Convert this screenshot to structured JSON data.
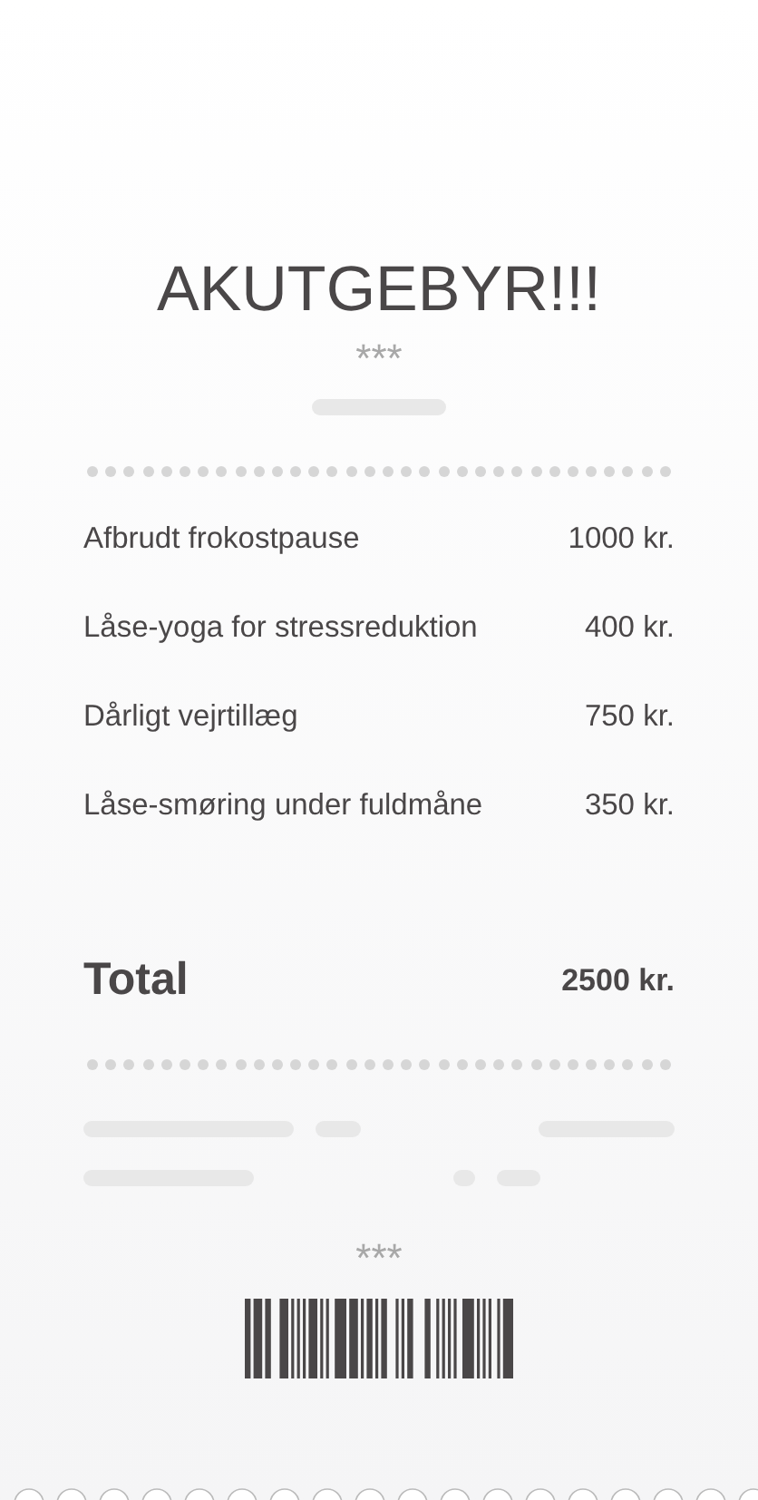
{
  "title": "AKUTGEBYR!!!",
  "stars_top": "***",
  "items": [
    {
      "name": "Afbrudt frokostpause",
      "amount": "1000 kr."
    },
    {
      "name": "Låse-yoga for stressreduktion",
      "amount": "400 kr."
    },
    {
      "name": "Dårligt vejrtillæg",
      "amount": "750 kr."
    },
    {
      "name": "Låse-smøring under fuldmåne",
      "amount": "350 kr."
    }
  ],
  "total": {
    "label": "Total",
    "amount": "2500 kr."
  },
  "stars_bottom": "***"
}
